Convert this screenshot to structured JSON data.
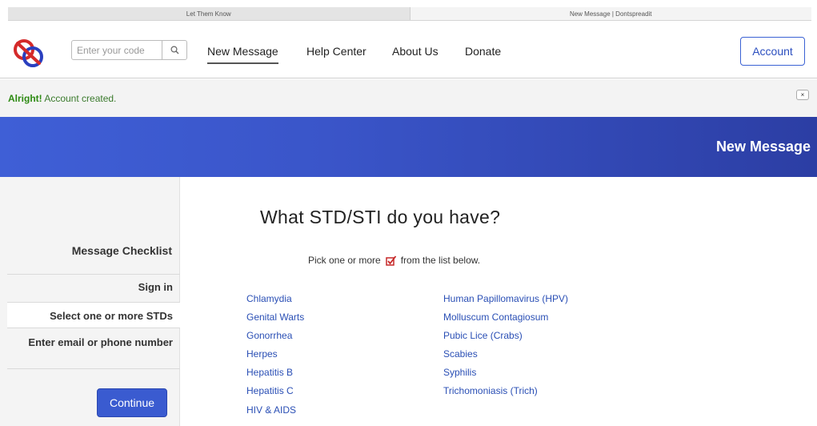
{
  "browser": {
    "tabs": [
      "Let Them Know",
      "New Message | Dontspreadit"
    ]
  },
  "header": {
    "search_placeholder": "Enter your code",
    "search_icon": "search-icon",
    "nav": [
      "New Message",
      "Help Center",
      "About Us",
      "Donate"
    ],
    "account_label": "Account"
  },
  "alert": {
    "strong": "Alright!",
    "message": " Account created.",
    "close_label": "×"
  },
  "banner": {
    "title": "New Message"
  },
  "sidebar": {
    "title": "Message Checklist",
    "items": [
      "Sign in",
      "Select one or more STDs",
      "Enter email or phone number"
    ],
    "continue_label": "Continue"
  },
  "main": {
    "heading": "What STD/STI do you have?",
    "instruction_before": "Pick one or more",
    "instruction_after": "from the list below.",
    "left_column": [
      "Chlamydia",
      "Genital Warts",
      "Gonorrhea",
      "Herpes",
      "Hepatitis B",
      "Hepatitis C",
      "HIV & AIDS"
    ],
    "right_column": [
      "Human Papillomavirus (HPV)",
      "Molluscum Contagiosum",
      "Pubic Lice (Crabs)",
      "Scabies",
      "Syphilis",
      "Trichomoniasis (Trich)"
    ]
  },
  "colors": {
    "accent": "#3a5bd0",
    "link": "#2a4fb5",
    "success": "#2d8a12",
    "logo_red": "#d42a2a",
    "logo_blue": "#2a3fbf"
  }
}
